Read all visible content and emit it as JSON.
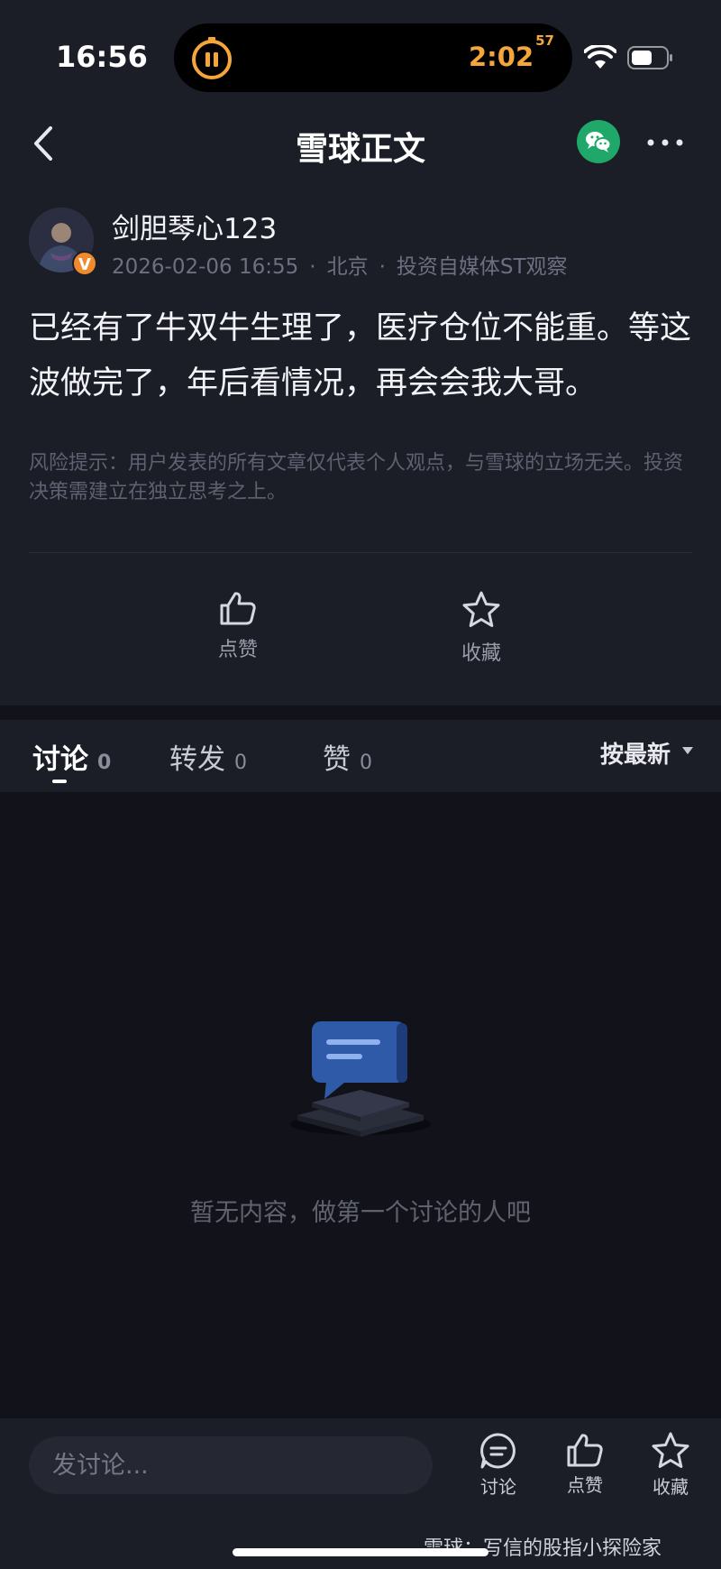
{
  "status_bar": {
    "time": "16:56",
    "timer_main": "2:02",
    "timer_sup": "57",
    "accent_color": "#f4a63a"
  },
  "nav": {
    "title": "雪球正文",
    "back_icon": "chevron-left-icon",
    "share_icon": "wechat-icon",
    "more_icon": "more-dots-icon"
  },
  "post": {
    "author": "剑胆琴心123",
    "verified_badge": "V",
    "date": "2026-02-06 16:55",
    "location": "北京",
    "category": "投资自媒体ST观察",
    "separator": "·",
    "body": "已经有了牛双牛生理了，医疗仓位不能重。等这波做完了，年后看情况，再会会我大哥。",
    "risk_note": "风险提示：用户发表的所有文章仅代表个人观点，与雪球的立场无关。投资决策需建立在独立思考之上。",
    "actions": {
      "like_label": "点赞",
      "favorite_label": "收藏"
    }
  },
  "tabs": {
    "items": [
      {
        "label": "讨论",
        "count": "0"
      },
      {
        "label": "转发",
        "count": "0"
      },
      {
        "label": "赞",
        "count": "0"
      }
    ],
    "sort_label": "按最新"
  },
  "empty_state": {
    "text": "暂无内容，做第一个讨论的人吧"
  },
  "bottom_bar": {
    "input_placeholder": "发讨论...",
    "discuss_label": "讨论",
    "like_label": "点赞",
    "favorite_label": "收藏",
    "watermark": "雪球：写信的股指小探险家"
  }
}
